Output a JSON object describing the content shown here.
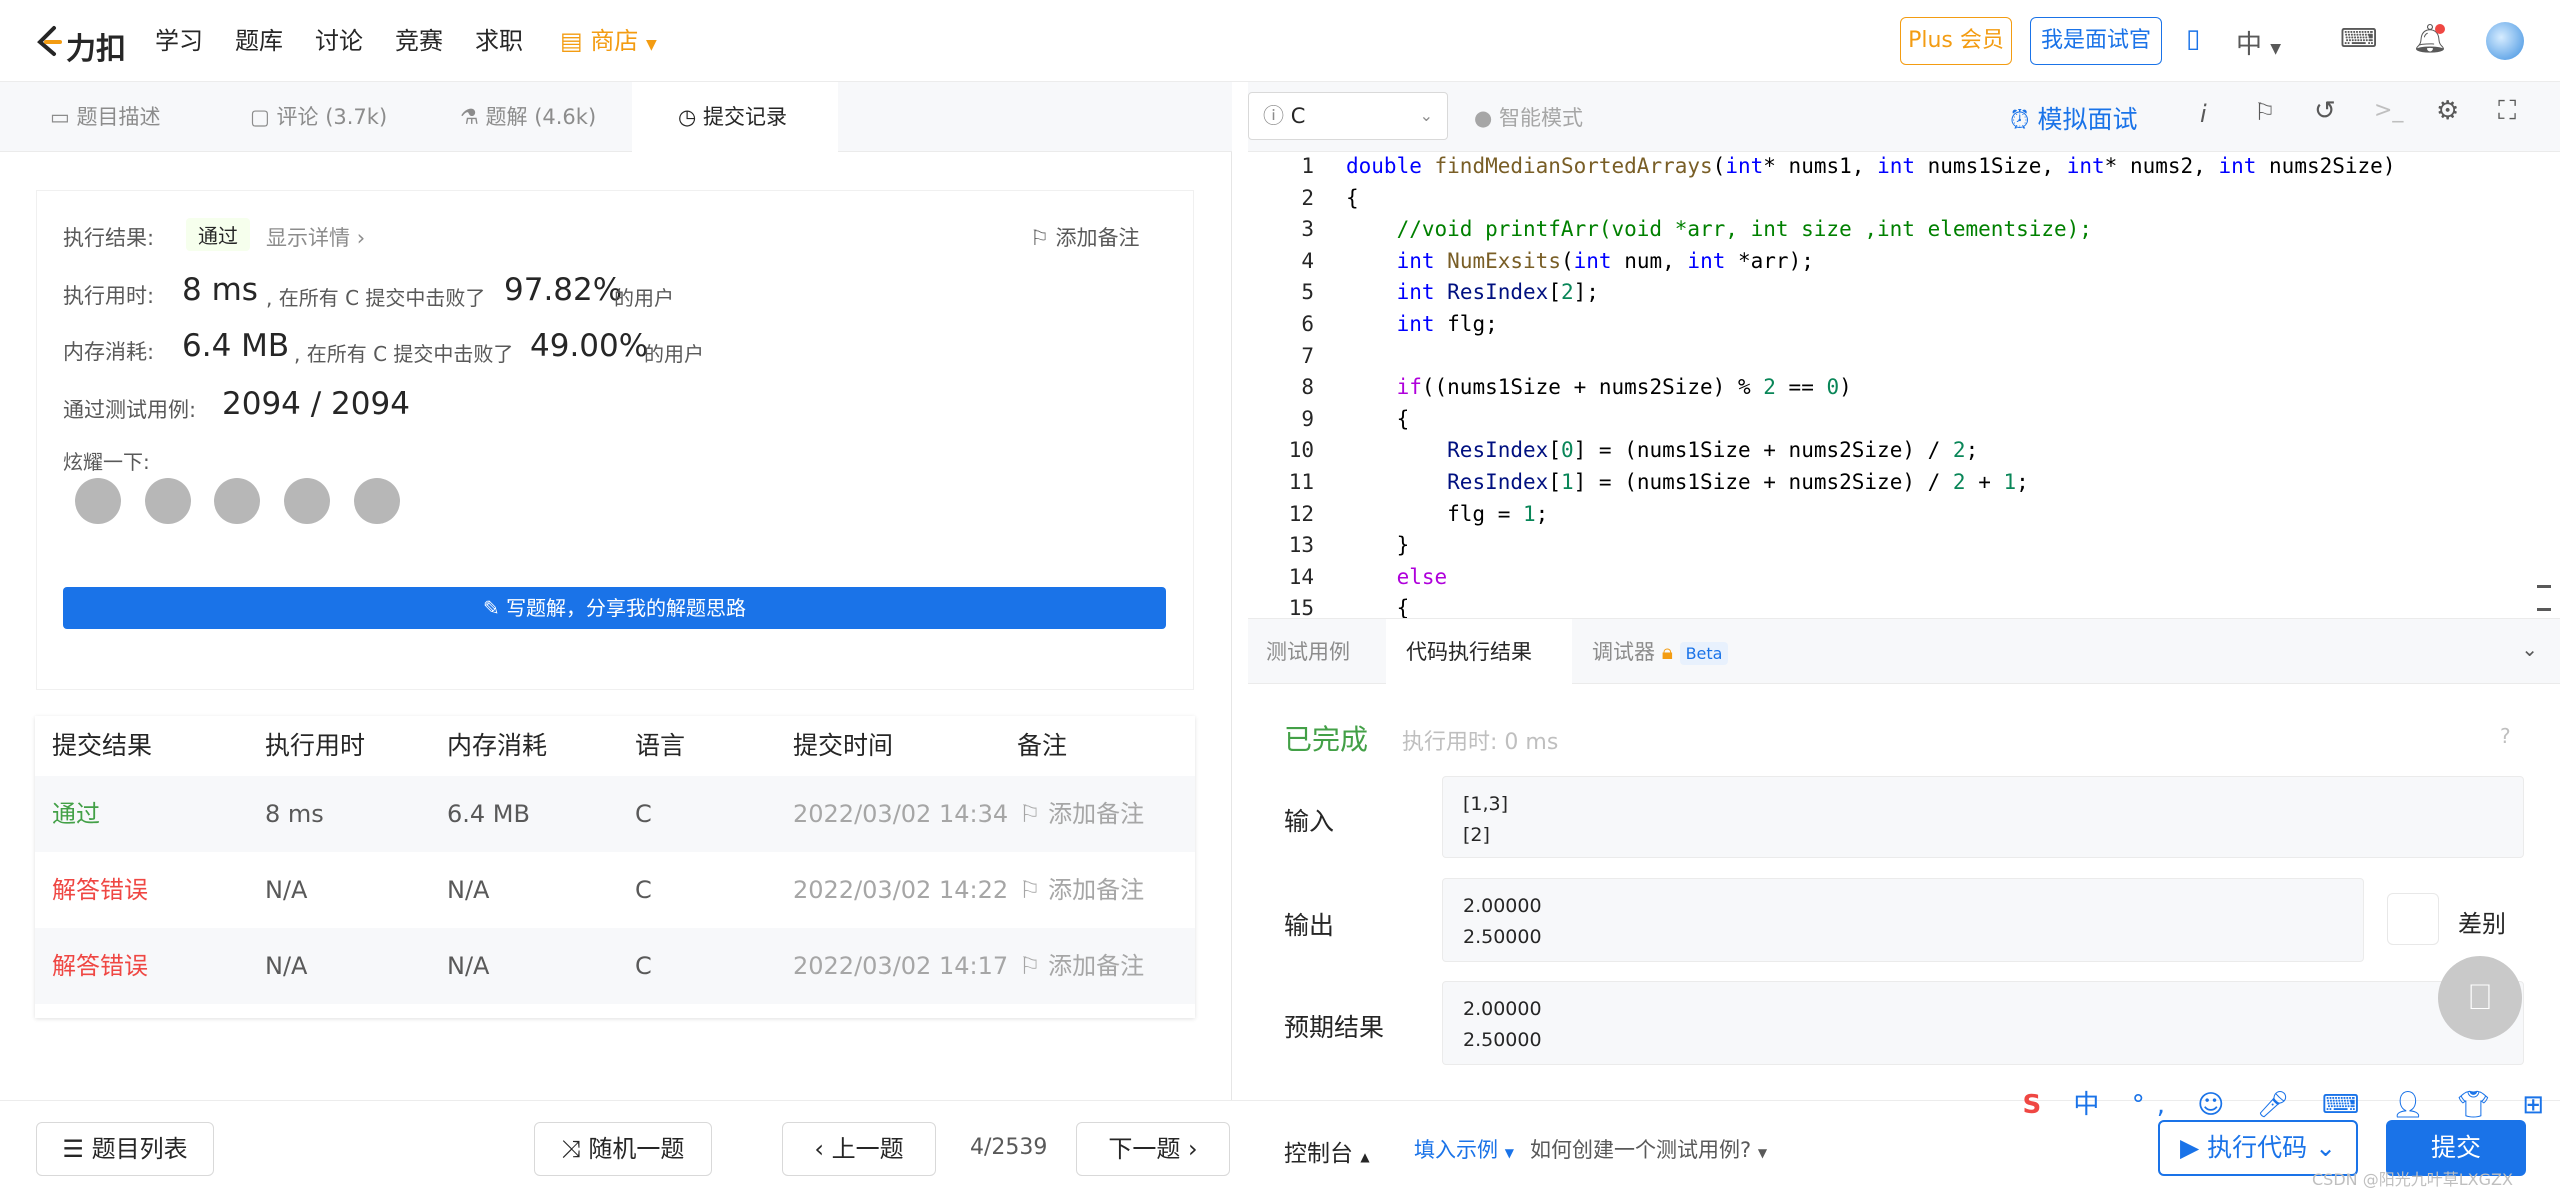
{
  "nav": {
    "logo": "力扣",
    "items": [
      "学习",
      "题库",
      "讨论",
      "竞赛",
      "求职"
    ],
    "shop": "商店",
    "plus": "Plus 会员",
    "interviewer": "我是面试官",
    "lang": "中"
  },
  "tabs": [
    {
      "label": "题目描述"
    },
    {
      "label": "评论 (3.7k)"
    },
    {
      "label": "题解 (4.6k)"
    },
    {
      "label": "提交记录"
    }
  ],
  "result": {
    "exec_label": "执行结果:",
    "status": "通过",
    "detail": "显示详情",
    "add_note": "添加备注",
    "time_label": "执行用时:",
    "time_value": "8 ms",
    "time_text": ", 在所有 C 提交中击败了",
    "time_pct": "97.82%",
    "users": "的用户",
    "mem_label": "内存消耗:",
    "mem_value": "6.4 MB",
    "mem_text": ", 在所有 C 提交中击败了",
    "mem_pct": "49.00%",
    "cases_label": "通过测试用例:",
    "cases_value": "2094 / 2094",
    "share_label": "炫耀一下:",
    "write_btn": "写题解，分享我的解题思路"
  },
  "table": {
    "headers": [
      "提交结果",
      "执行用时",
      "内存消耗",
      "语言",
      "提交时间",
      "备注"
    ],
    "rows": [
      {
        "result": "通过",
        "time": "8 ms",
        "memory": "6.4 MB",
        "lang": "C",
        "date": "2022/03/02 14:34",
        "note": "添加备注"
      },
      {
        "result": "解答错误",
        "time": "N/A",
        "memory": "N/A",
        "lang": "C",
        "date": "2022/03/02 14:22",
        "note": "添加备注"
      },
      {
        "result": "解答错误",
        "time": "N/A",
        "memory": "N/A",
        "lang": "C",
        "date": "2022/03/02 14:17",
        "note": "添加备注"
      }
    ]
  },
  "bottom": {
    "problem_list": "题目列表",
    "random": "随机一题",
    "prev": "上一题",
    "page": "4/2539",
    "next": "下一题",
    "console": "控制台",
    "fill_example": "填入示例",
    "how_create": "如何创建一个测试用例?",
    "run": "执行代码",
    "submit": "提交"
  },
  "editor": {
    "language": "C",
    "smart_mode": "智能模式",
    "mock_interview": "模拟面试"
  },
  "code_lines": [
    "double findMedianSortedArrays(int* nums1, int nums1Size, int* nums2, int nums2Size)",
    "{",
    "    //void printfArr(void *arr, int size ,int elementsize);",
    "    int NumExsits(int num, int *arr);",
    "    int ResIndex[2];",
    "    int flg;",
    "",
    "    if((nums1Size + nums2Size) % 2 == 0)",
    "    {",
    "        ResIndex[0] = (nums1Size + nums2Size) / 2;",
    "        ResIndex[1] = (nums1Size + nums2Size) / 2 + 1;",
    "        flg = 1;",
    "    }",
    "    else",
    "    {"
  ],
  "line_numbers": [
    "1",
    "2",
    "3",
    "4",
    "5",
    "6",
    "7",
    "8",
    "9",
    "10",
    "11",
    "12",
    "13",
    "14",
    "15"
  ],
  "result_panel": {
    "tabs": [
      "测试用例",
      "代码执行结果",
      "调试器"
    ],
    "beta": "Beta",
    "done": "已完成",
    "exec_time": "执行用时: 0 ms",
    "input_label": "输入",
    "input_value": "[1,3]\n[2]",
    "output_label": "输出",
    "output_value": "2.00000\n2.50000",
    "diff": "差别",
    "expected_label": "预期结果",
    "expected_value": "2.00000\n2.50000"
  },
  "watermark": "CSDN @阳光九叶草LXGZX",
  "colors": {
    "accent": "#1a73e8",
    "success": "#43a047",
    "error": "#ef4743",
    "shop": "#f39c12"
  }
}
